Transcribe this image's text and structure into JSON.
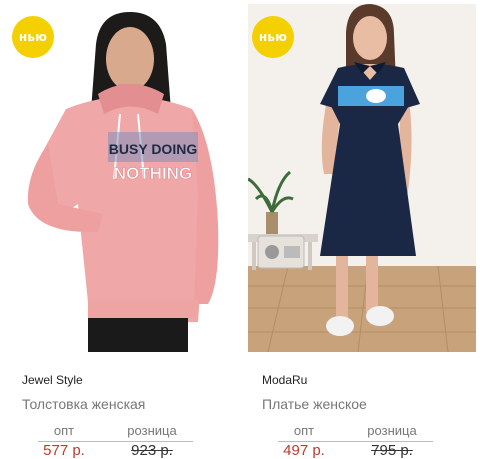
{
  "products": [
    {
      "badge": "нью",
      "brand": "Jewel Style",
      "title": "Толстовка женская",
      "opt_label": "опт",
      "opt_price": "577 р.",
      "retail_label": "розница",
      "retail_price": "923 р.",
      "print_line1": "BUSY DOING",
      "print_line2": "NOTHING"
    },
    {
      "badge": "нью",
      "brand": "ModaRu",
      "title": "Платье женское",
      "opt_label": "опт",
      "opt_price": "497 р.",
      "retail_label": "розница",
      "retail_price": "795 р."
    }
  ],
  "colors": {
    "badge": "#f5d000",
    "opt_price": "#c0392b",
    "hoodie": "#f0a7a7",
    "dress": "#1a2745",
    "dress_stripe": "#4aa3dd"
  }
}
